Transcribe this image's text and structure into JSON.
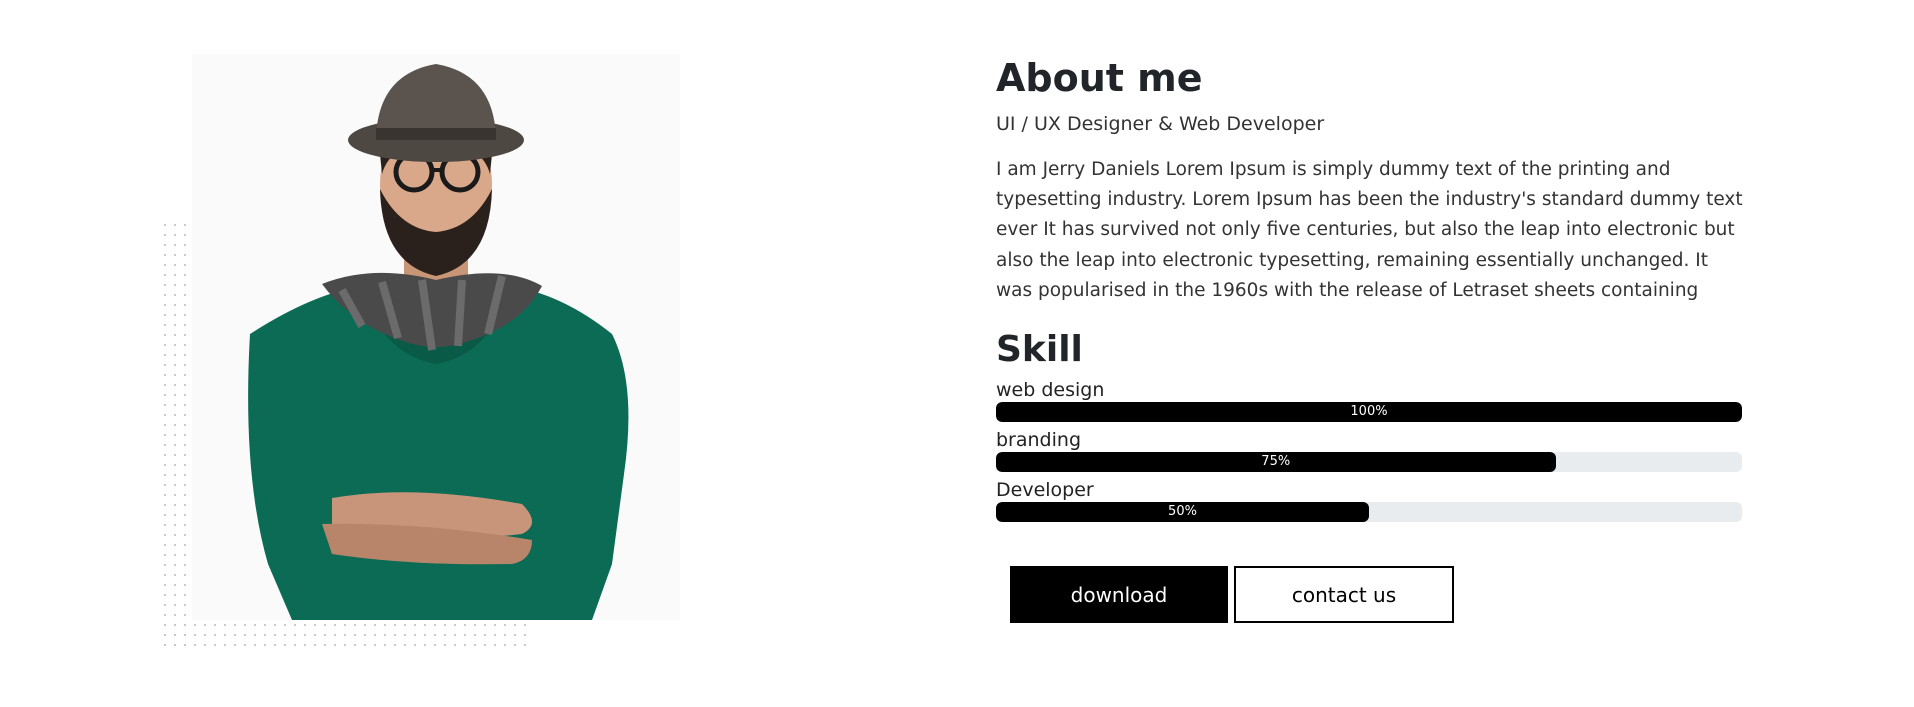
{
  "about": {
    "title": "About me",
    "subtitle": "UI / UX Designer & Web Developer",
    "body": "I am Jerry Daniels Lorem Ipsum is simply dummy text of the printing and typesetting industry. Lorem Ipsum has been the industry's standard dummy text ever It has survived not only five centuries, but also the leap into electronic but also the leap into electronic typesetting, remaining essentially unchanged. It was popularised in the 1960s with the release of Letraset sheets containing"
  },
  "skills": {
    "title": "Skill",
    "items": [
      {
        "label": "web design",
        "percent": 100,
        "percent_label": "100%"
      },
      {
        "label": "branding",
        "percent": 75,
        "percent_label": "75%"
      },
      {
        "label": "Developer",
        "percent": 50,
        "percent_label": "50%"
      }
    ]
  },
  "buttons": {
    "download_label": "download",
    "contact_label": "contact us"
  },
  "colors": {
    "accent": "#000000",
    "track": "#e9ecef",
    "sweater": "#0b6b55"
  }
}
